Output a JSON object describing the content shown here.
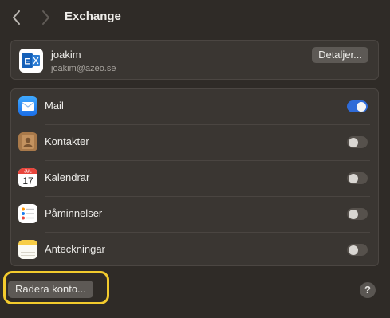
{
  "window": {
    "title": "Exchange"
  },
  "account": {
    "name": "joakim",
    "email": "joakim@azeo.se",
    "details_label": "Detaljer..."
  },
  "services": [
    {
      "label": "Mail",
      "icon": "mail-icon",
      "enabled": true
    },
    {
      "label": "Kontakter",
      "icon": "contacts-icon",
      "enabled": false
    },
    {
      "label": "Kalendrar",
      "icon": "calendar-icon",
      "enabled": false,
      "calendar_month": "JUL",
      "calendar_day": "17"
    },
    {
      "label": "Påminnelser",
      "icon": "reminders-icon",
      "enabled": false
    },
    {
      "label": "Anteckningar",
      "icon": "notes-icon",
      "enabled": false
    }
  ],
  "footer": {
    "delete_label": "Radera konto...",
    "help_label": "?"
  },
  "colors": {
    "accent": "#2f6bd8",
    "highlight": "#f3cb2d",
    "background": "#2f2b27"
  }
}
